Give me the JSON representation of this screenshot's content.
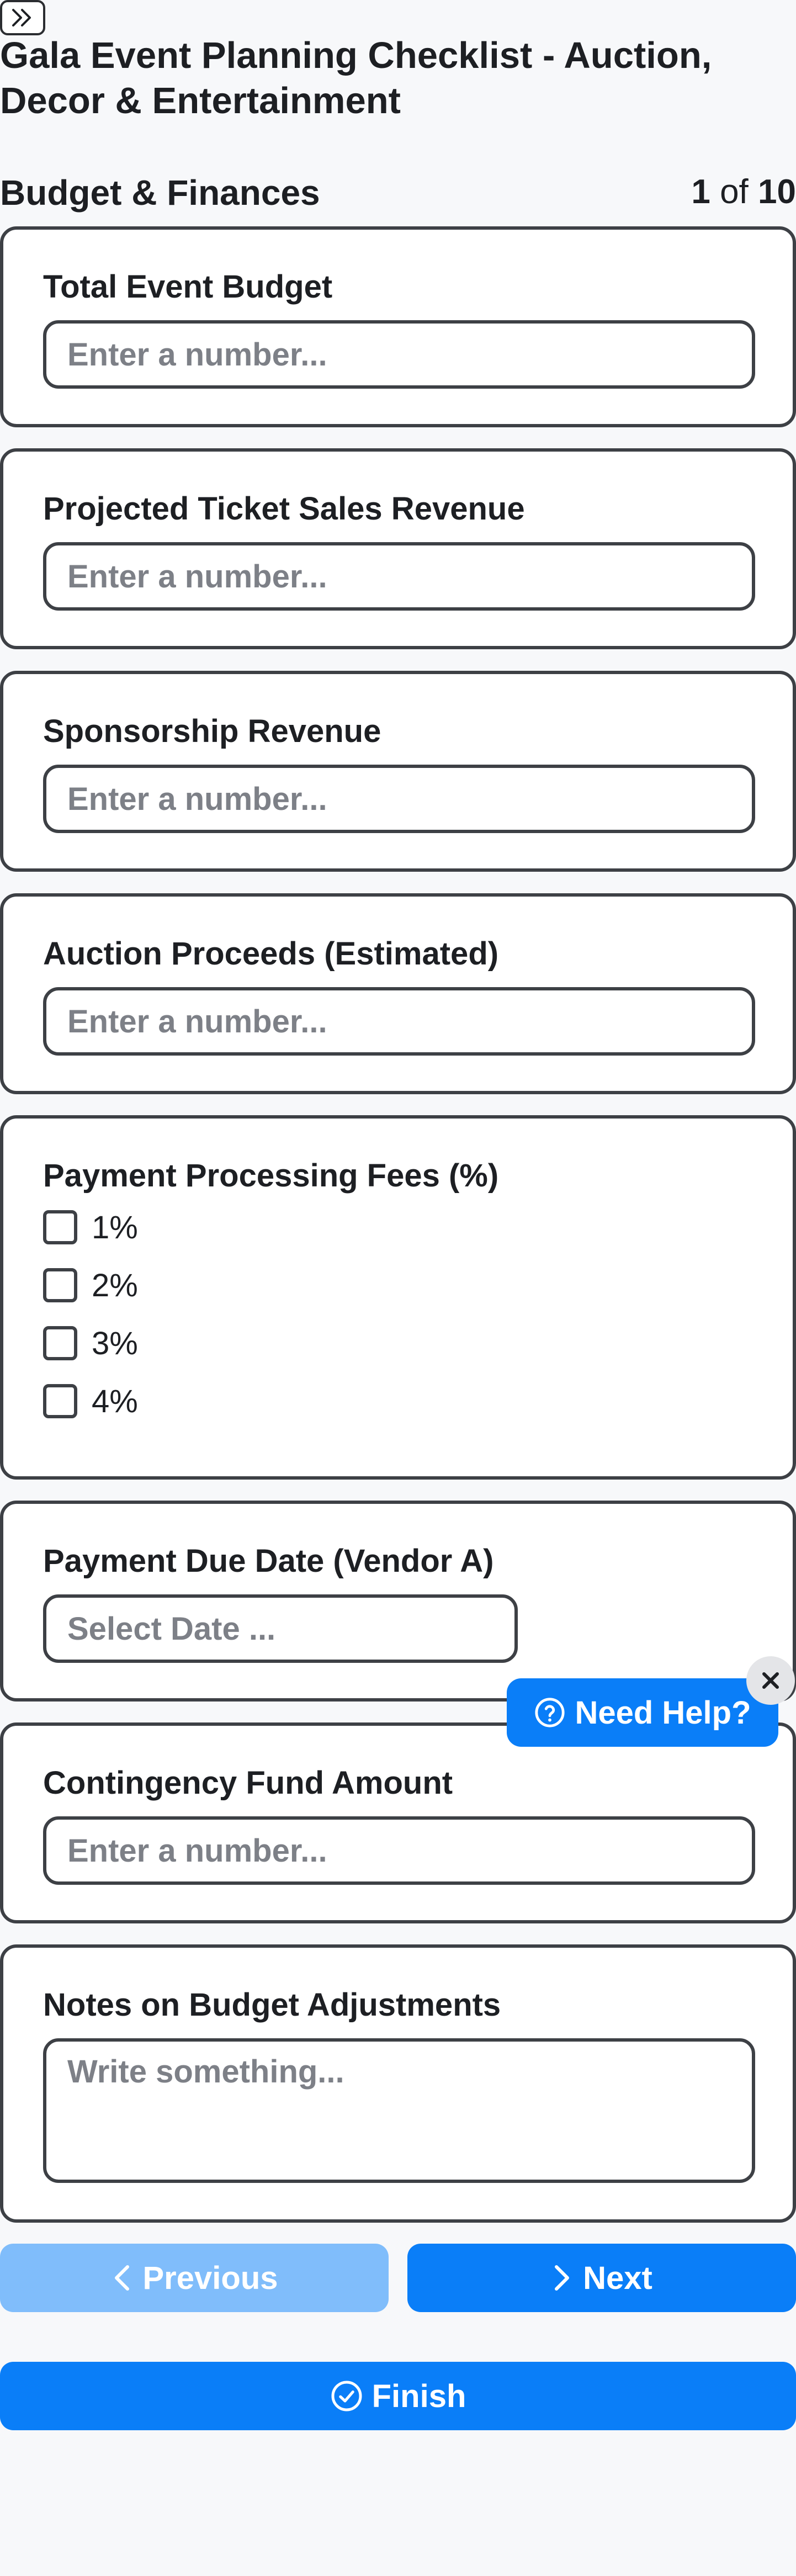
{
  "page": {
    "title": "Gala Event Planning Checklist - Auction, Decor & Entertainment"
  },
  "section": {
    "title": "Budget & Finances",
    "current_page": "1",
    "of_label": "of",
    "total_pages": "10"
  },
  "fields": {
    "total_budget": {
      "label": "Total Event Budget",
      "placeholder": "Enter a number..."
    },
    "ticket_revenue": {
      "label": "Projected Ticket Sales Revenue",
      "placeholder": "Enter a number..."
    },
    "sponsorship_revenue": {
      "label": "Sponsorship Revenue",
      "placeholder": "Enter a number..."
    },
    "auction_proceeds": {
      "label": "Auction Proceeds (Estimated)",
      "placeholder": "Enter a number..."
    },
    "processing_fees": {
      "label": "Payment Processing Fees (%)",
      "options": [
        "1%",
        "2%",
        "3%",
        "4%"
      ]
    },
    "payment_due_date": {
      "label": "Payment Due Date (Vendor A)",
      "placeholder": "Select Date ..."
    },
    "contingency_fund": {
      "label": "Contingency Fund Amount",
      "placeholder": "Enter a number..."
    },
    "budget_notes": {
      "label": "Notes on Budget Adjustments",
      "placeholder": "Write something..."
    }
  },
  "help": {
    "label": "Need Help?",
    "icon": "question-circle-icon",
    "close_icon": "close-icon"
  },
  "navigation": {
    "previous_label": "Previous",
    "next_label": "Next",
    "finish_label": "Finish"
  },
  "colors": {
    "primary": "#0a7ef8",
    "primary_disabled": "#80bdfb",
    "border": "#3d4045",
    "placeholder": "#7d8087",
    "background": "#f7f8fa"
  }
}
